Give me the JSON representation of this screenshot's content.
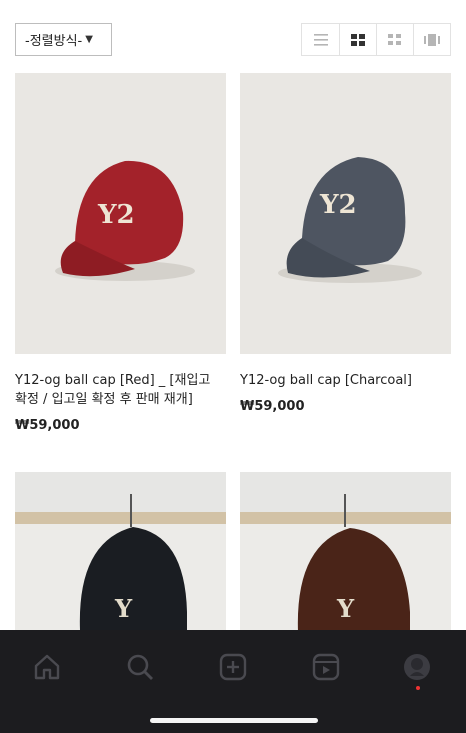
{
  "toolbar": {
    "sort_label": "-정렬방식-",
    "view_modes": [
      "list-view-icon",
      "two-column-grid-icon",
      "small-grid-icon",
      "gallery-view-icon"
    ],
    "active_view": "two-column-grid-icon"
  },
  "products": [
    {
      "name": "Y12-og ball cap [Red] _ [재입고 확정 / 입고일 확정 후 판매 재개]",
      "price": "₩59,000",
      "cap_color": "#a3222a"
    },
    {
      "name": "Y12-og ball cap [Charcoal]",
      "price": "₩59,000",
      "cap_color": "#4e5561"
    },
    {
      "name": "",
      "price": "",
      "cap_color": "#1a1d22"
    },
    {
      "name": "",
      "price": "",
      "cap_color": "#4a2418"
    }
  ],
  "bottom_nav": [
    "home-icon",
    "search-icon",
    "add-post-icon",
    "reels-icon",
    "profile-avatar-icon"
  ],
  "colors": {
    "accent_dot": "#e33333",
    "nav_bg": "#1c1c1f"
  }
}
